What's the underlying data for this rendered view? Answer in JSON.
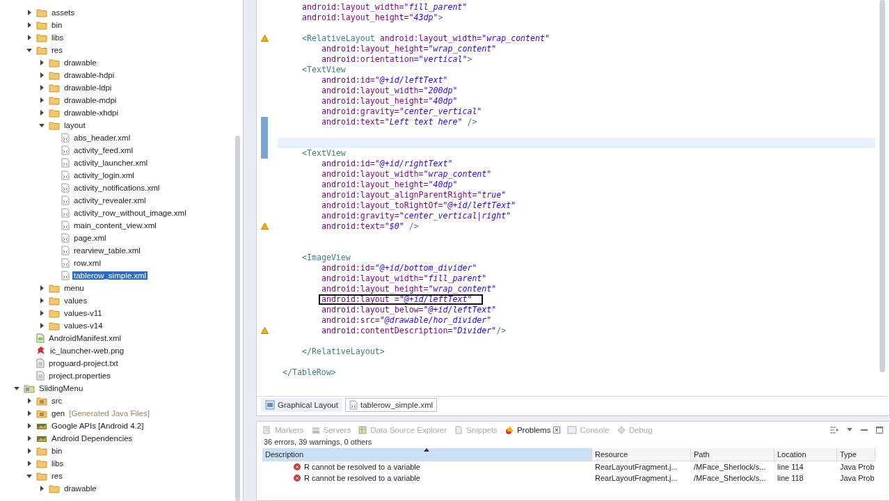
{
  "package_explorer": {
    "tree": {
      "partial_top": [
        {
          "label": "assets",
          "kind": "folder",
          "expanded": false
        },
        {
          "label": "bin",
          "kind": "folder",
          "expanded": false
        },
        {
          "label": "libs",
          "kind": "folder",
          "expanded": false
        },
        {
          "label": "res",
          "kind": "folder",
          "expanded": true,
          "children": [
            {
              "label": "drawable",
              "kind": "folder",
              "expanded": false
            },
            {
              "label": "drawable-hdpi",
              "kind": "folder",
              "expanded": false
            },
            {
              "label": "drawable-ldpi",
              "kind": "folder",
              "expanded": false
            },
            {
              "label": "drawable-mdpi",
              "kind": "folder",
              "expanded": false
            },
            {
              "label": "drawable-xhdpi",
              "kind": "folder",
              "expanded": false
            },
            {
              "label": "layout",
              "kind": "folder",
              "expanded": true,
              "children": [
                {
                  "label": "abs_header.xml",
                  "kind": "xml",
                  "selected": false
                },
                {
                  "label": "activity_feed.xml",
                  "kind": "xml",
                  "selected": false
                },
                {
                  "label": "activity_launcher.xml",
                  "kind": "xml",
                  "selected": false
                },
                {
                  "label": "activity_login.xml",
                  "kind": "xml",
                  "selected": false
                },
                {
                  "label": "activity_notifications.xml",
                  "kind": "xml",
                  "selected": false
                },
                {
                  "label": "activity_revealer.xml",
                  "kind": "xml",
                  "selected": false
                },
                {
                  "label": "activity_row_without_image.xml",
                  "kind": "xml",
                  "selected": false
                },
                {
                  "label": "main_content_view.xml",
                  "kind": "xml",
                  "selected": false
                },
                {
                  "label": "page.xml",
                  "kind": "xml",
                  "selected": false
                },
                {
                  "label": "rearview_table.xml",
                  "kind": "xml",
                  "selected": false
                },
                {
                  "label": "row.xml",
                  "kind": "xml",
                  "selected": false
                },
                {
                  "label": "tablerow_simple.xml",
                  "kind": "xml",
                  "selected": true
                }
              ]
            },
            {
              "label": "menu",
              "kind": "folder",
              "expanded": false
            },
            {
              "label": "values",
              "kind": "folder",
              "expanded": false
            },
            {
              "label": "values-v11",
              "kind": "folder",
              "expanded": false
            },
            {
              "label": "values-v14",
              "kind": "folder",
              "expanded": false
            }
          ]
        },
        {
          "label": "AndroidManifest.xml",
          "kind": "manifest",
          "selected": false
        },
        {
          "label": "ic_launcher-web.png",
          "kind": "image",
          "selected": false
        },
        {
          "label": "proguard-project.txt",
          "kind": "text",
          "selected": false
        },
        {
          "label": "project.properties",
          "kind": "text",
          "selected": false
        }
      ],
      "roots": [
        {
          "label": "SlidingMenu",
          "kind": "project",
          "expanded": true,
          "children": [
            {
              "label": "src",
              "kind": "source",
              "expanded": false
            },
            {
              "label": "gen",
              "decoration": "[Generated Java Files]",
              "kind": "source",
              "expanded": false
            },
            {
              "label": "Google APIs [Android 4.2]",
              "kind": "library",
              "expanded": false
            },
            {
              "label": "Android Dependencies",
              "kind": "library",
              "expanded": false
            },
            {
              "label": "bin",
              "kind": "folder",
              "expanded": false
            },
            {
              "label": "libs",
              "kind": "folder",
              "expanded": false
            },
            {
              "label": "res",
              "kind": "folder",
              "expanded": true,
              "children": [
                {
                  "label": "drawable",
                  "kind": "folder",
                  "expanded": false
                }
              ]
            }
          ]
        }
      ]
    }
  },
  "editor": {
    "partial_top": [
      {
        "tokens": [
          {
            "kind": "attr",
            "text": "android:layout_width="
          },
          {
            "kind": "value",
            "text": "\"fill_parent\""
          }
        ]
      },
      {
        "tokens": [
          {
            "kind": "attr",
            "text": "android:layout_height="
          },
          {
            "kind": "value",
            "text": "\"43dp\""
          },
          {
            "kind": "tag",
            "text": ">"
          }
        ]
      },
      {
        "kind": "blank"
      },
      {
        "warning": true,
        "tokens": [
          {
            "kind": "tag",
            "text": "<RelativeLayout "
          },
          {
            "kind": "attr",
            "text": "android:layout_width="
          },
          {
            "kind": "value",
            "text": "\"wrap_content\""
          }
        ],
        "children": [
          {
            "tokens": [
              {
                "kind": "attr",
                "text": "android:layout_height="
              },
              {
                "kind": "value",
                "text": "\"wrap_content\""
              }
            ]
          },
          {
            "tokens": [
              {
                "kind": "attr",
                "text": "android:orientation="
              },
              {
                "kind": "value",
                "text": "\"vertical\""
              },
              {
                "kind": "tag",
                "text": ">"
              }
            ]
          }
        ]
      },
      {
        "tokens": [
          {
            "kind": "tag",
            "text": "<TextView"
          }
        ],
        "children": [
          {
            "tokens": [
              {
                "kind": "attr",
                "text": "android:id="
              },
              {
                "kind": "value",
                "text": "\"@+id/leftText\""
              }
            ]
          },
          {
            "tokens": [
              {
                "kind": "attr",
                "text": "android:layout_width="
              },
              {
                "kind": "value",
                "text": "\"200dp\""
              }
            ]
          },
          {
            "tokens": [
              {
                "kind": "attr",
                "text": "android:layout_height="
              },
              {
                "kind": "value",
                "text": "\"40dp\""
              }
            ]
          },
          {
            "tokens": [
              {
                "kind": "attr",
                "text": "android:gravity="
              },
              {
                "kind": "value",
                "text": "\"center_vertical\""
              }
            ]
          },
          {
            "in_range": true,
            "tokens": [
              {
                "kind": "attr",
                "text": "android:text="
              },
              {
                "kind": "value",
                "text": "\"Left text here\""
              },
              {
                "kind": "tag",
                "text": " />"
              }
            ]
          },
          {
            "in_range": true
          },
          {
            "in_range": true,
            "current": true
          }
        ]
      },
      {
        "in_range": true,
        "tokens": [
          {
            "kind": "tag",
            "text": "<TextView"
          }
        ],
        "children": [
          {
            "tokens": [
              {
                "kind": "attr",
                "text": "android:id="
              },
              {
                "kind": "value",
                "text": "\"@+id/rightText\""
              }
            ]
          },
          {
            "tokens": [
              {
                "kind": "attr",
                "text": "android:layout_width="
              },
              {
                "kind": "value",
                "text": "\"wrap_content\""
              }
            ]
          },
          {
            "tokens": [
              {
                "kind": "attr",
                "text": "android:layout_height="
              },
              {
                "kind": "value",
                "text": "\"40dp\""
              }
            ]
          },
          {
            "tokens": [
              {
                "kind": "attr",
                "text": "android:layout_alignParentRight="
              },
              {
                "kind": "value",
                "text": "\"true\""
              }
            ]
          },
          {
            "tokens": [
              {
                "kind": "attr",
                "text": "android:layout_toRightOf="
              },
              {
                "kind": "value",
                "text": "\"@+id/leftText\""
              }
            ]
          },
          {
            "tokens": [
              {
                "kind": "attr",
                "text": "android:gravity="
              },
              {
                "kind": "value",
                "text": "\"center_vertical|right\""
              }
            ]
          },
          {
            "warning": true,
            "tokens": [
              {
                "kind": "attr",
                "text": "android:text="
              },
              {
                "kind": "value",
                "text": "\"$0\""
              },
              {
                "kind": "tag",
                "text": " />"
              }
            ]
          },
          {
            "kind": "blank"
          },
          {
            "kind": "blank"
          }
        ]
      },
      {
        "tokens": [
          {
            "kind": "tag",
            "text": "<ImageView"
          }
        ],
        "children": [
          {
            "tokens": [
              {
                "kind": "attr",
                "text": "android:id="
              },
              {
                "kind": "value",
                "text": "\"@+id/bottom_divider\""
              }
            ]
          },
          {
            "tokens": [
              {
                "kind": "attr",
                "text": "android:layout_width="
              },
              {
                "kind": "value",
                "text": "\"fill_parent\""
              }
            ]
          },
          {
            "tokens": [
              {
                "kind": "attr",
                "text": "android:layout_height="
              },
              {
                "kind": "value",
                "text": "\"wrap_content\""
              }
            ]
          },
          {
            "boxed": true,
            "tokens": [
              {
                "kind": "attr",
                "text": "android:layout_="
              },
              {
                "kind": "value",
                "text": "\"@+id/leftText\""
              }
            ]
          },
          {
            "tokens": [
              {
                "kind": "attr",
                "text": "android:layout_below="
              },
              {
                "kind": "value",
                "text": "\"@+id/leftText\""
              }
            ]
          },
          {
            "tokens": [
              {
                "kind": "attr",
                "text": "android:src="
              },
              {
                "kind": "value",
                "text": "\"@drawable/hor_divider\""
              }
            ]
          },
          {
            "warning": true,
            "tokens": [
              {
                "kind": "attr",
                "text": "android:contentDescription="
              },
              {
                "kind": "value",
                "text": "\"Divider\""
              },
              {
                "kind": "tag",
                "text": "/>"
              }
            ]
          },
          {
            "kind": "blank"
          }
        ]
      },
      {
        "tokens": [
          {
            "kind": "tag",
            "text": "</RelativeLayout>"
          }
        ]
      },
      {
        "kind": "blank"
      }
    ],
    "lines": [
      {
        "tokens": [
          {
            "kind": "tag",
            "text": "</TableRow>"
          }
        ]
      }
    ],
    "tabs": [
      {
        "label": "Graphical Layout",
        "kind": "design",
        "selected": false
      },
      {
        "label": "tablerow_simple.xml",
        "kind": "xml",
        "selected": true
      }
    ]
  },
  "bottom_panel": {
    "tabs": [
      {
        "label": "Markers",
        "kind": "markers",
        "selected": false
      },
      {
        "label": "Servers",
        "kind": "servers",
        "selected": false
      },
      {
        "label": "Data Source Explorer",
        "kind": "datasource",
        "selected": false
      },
      {
        "label": "Snippets",
        "kind": "snippets",
        "selected": false
      },
      {
        "label": "Problems",
        "kind": "problems",
        "selected": true
      },
      {
        "label": "Console",
        "kind": "console",
        "selected": false
      },
      {
        "label": "Debug",
        "kind": "debug",
        "selected": false
      }
    ],
    "summary": "36 errors, 39 warnings, 0 others",
    "table": {
      "columns": [
        {
          "label": "Description",
          "sorted": true
        },
        {
          "label": "Resource",
          "sorted": false
        },
        {
          "label": "Path",
          "sorted": false
        },
        {
          "label": "Location",
          "sorted": false
        },
        {
          "label": "Type",
          "sorted": false
        }
      ],
      "rows": [
        {
          "kind": "error",
          "cells": [
            "R cannot be resolved to a variable",
            "RearLayoutFragment.j...",
            "/MFace_Sherlock/s...",
            "line 114",
            "Java Prob"
          ]
        },
        {
          "kind": "error",
          "cells": [
            "R cannot be resolved to a variable",
            "RearLayoutFragment.j...",
            "/MFace_Sherlock/s...",
            "line 118",
            "Java Prob"
          ]
        }
      ]
    }
  }
}
